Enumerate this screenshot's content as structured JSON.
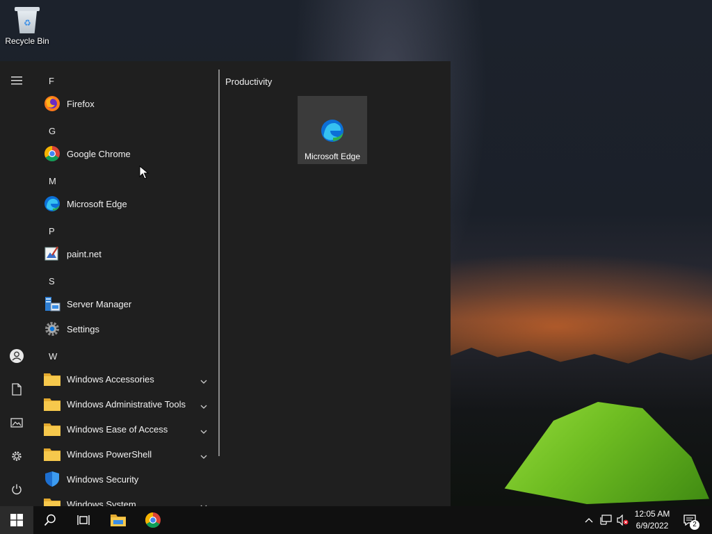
{
  "desktop": {
    "recycle_bin_label": "Recycle Bin"
  },
  "start_menu": {
    "rail": {
      "items": [
        {
          "name": "expand",
          "icon": "hamburger-icon"
        },
        {
          "name": "account",
          "icon": "user-icon"
        },
        {
          "name": "documents",
          "icon": "document-icon"
        },
        {
          "name": "pictures",
          "icon": "picture-icon"
        },
        {
          "name": "settings",
          "icon": "gear-icon"
        },
        {
          "name": "power",
          "icon": "power-icon"
        }
      ]
    },
    "letters": [
      "F",
      "G",
      "M",
      "P",
      "S",
      "W"
    ],
    "apps": [
      {
        "name": "Firefox",
        "icon": "firefox-icon"
      },
      {
        "name": "Google Chrome",
        "icon": "chrome-icon"
      },
      {
        "name": "Microsoft Edge",
        "icon": "edge-icon"
      },
      {
        "name": "paint.net",
        "icon": "paintnet-icon"
      },
      {
        "name": "Server Manager",
        "icon": "server-manager-icon"
      },
      {
        "name": "Settings",
        "icon": "gear-icon"
      },
      {
        "name": "Windows Accessories",
        "icon": "folder-icon",
        "expandable": true
      },
      {
        "name": "Windows Administrative Tools",
        "icon": "folder-icon",
        "expandable": true
      },
      {
        "name": "Windows Ease of Access",
        "icon": "folder-icon",
        "expandable": true
      },
      {
        "name": "Windows PowerShell",
        "icon": "folder-icon",
        "expandable": true
      },
      {
        "name": "Windows Security",
        "icon": "shield-icon"
      },
      {
        "name": "Windows System",
        "icon": "folder-icon",
        "expandable": true
      }
    ],
    "tiles_group": {
      "title": "Productivity",
      "tiles": [
        {
          "label": "Microsoft Edge",
          "icon": "edge-icon"
        }
      ]
    }
  },
  "taskbar": {
    "items": [
      "windows-start-icon",
      "search-icon",
      "task-view-icon",
      "file-explorer-icon",
      "chrome-icon"
    ],
    "tray": {
      "icons": [
        "chevron-up-icon",
        "network-icon",
        "volume-muted-icon"
      ],
      "time": "12:05 AM",
      "date": "6/9/2022",
      "notification_count": "2"
    }
  },
  "colors": {
    "start_bg": "#1f1f1f",
    "taskbar_bg": "#101010",
    "tile_bg": "#3b3b3b",
    "folder": "#f4c542",
    "accent_blue": "#0a74d9"
  }
}
